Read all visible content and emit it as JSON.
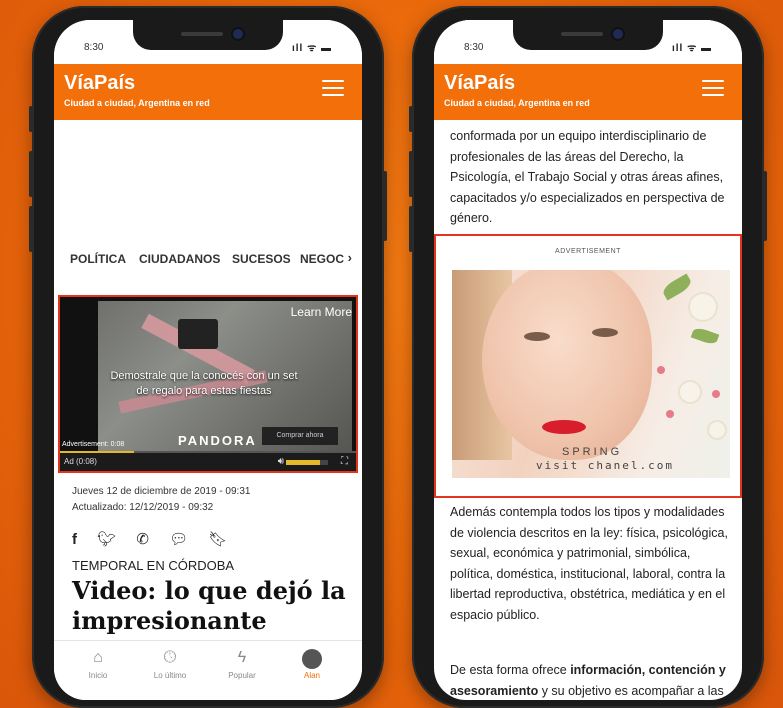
{
  "left_phone": {
    "status_time": "8:30",
    "status_icons": "ıll ᯤ ▬",
    "brand": "VíaPaís",
    "tagline": "Ciudad a ciudad, Argentina en red",
    "menu_icon": "hamburger-icon",
    "tabs": [
      "POLÍTICA",
      "CIUDADANOS",
      "SUCESOS",
      "NEGOCI"
    ],
    "tabs_chevron": "›",
    "video": {
      "learn_more": "Learn More",
      "caption": "Demostrale que la conocés con un set de regalo para estas fiestas",
      "brand": "PANDORA",
      "ad_label": "Advertisement: 0:08",
      "cta": "Comprar ahora",
      "time": "Ad (0:08)",
      "volume_level": 0.8,
      "progress": 0.25
    },
    "date_published": "Jueves 12 de diciembre de 2019 - 09:31",
    "date_updated": "Actualizado: 12/12/2019 - 09:32",
    "share_icons": [
      "facebook-icon",
      "twitter-icon",
      "whatsapp-icon",
      "comment-icon",
      "bookmark-icon"
    ],
    "section": "TEMPORAL EN CÓRDOBA",
    "headline": "Video: lo que dejó la impresionante",
    "bottom_nav": [
      {
        "label": "Inicio",
        "icon": "home-icon"
      },
      {
        "label": "Lo último",
        "icon": "clock-icon"
      },
      {
        "label": "Popular",
        "icon": "lightning-icon"
      },
      {
        "label": "Alan",
        "icon": "avatar-icon"
      }
    ]
  },
  "right_phone": {
    "status_time": "8:30",
    "status_icons": "ıll ᯤ ▬",
    "brand": "VíaPaís",
    "tagline": "Ciudad a ciudad, Argentina en red",
    "paragraph_top": "conformada por un equipo interdisciplinario de profesionales de las áreas del Derecho, la Psicología, el Trabajo Social y otras áreas afines, capacitados y/o especializados en perspectiva de género.",
    "ad_label": "ADVERTISEMENT",
    "ad_line1": "SPRING",
    "ad_line2": "visit chanel.com",
    "paragraph_mid": "Además contempla todos los tipos y modalidades de violencia descritos en la ley: física, psicológica, sexual, económica y patrimonial, simbólica, política, doméstica, institucional, laboral, contra la libertad reproductiva, obstétrica, mediática y en el espacio público.",
    "paragraph_end_before": "De esta forma ofrece ",
    "paragraph_end_bold1": "información, contención y asesoramiento",
    "paragraph_end_after": " y su objetivo es acompañar a las"
  },
  "colors": {
    "accent": "#f26f0a",
    "highlight_border": "#e1351e",
    "background": "#e8660a"
  }
}
